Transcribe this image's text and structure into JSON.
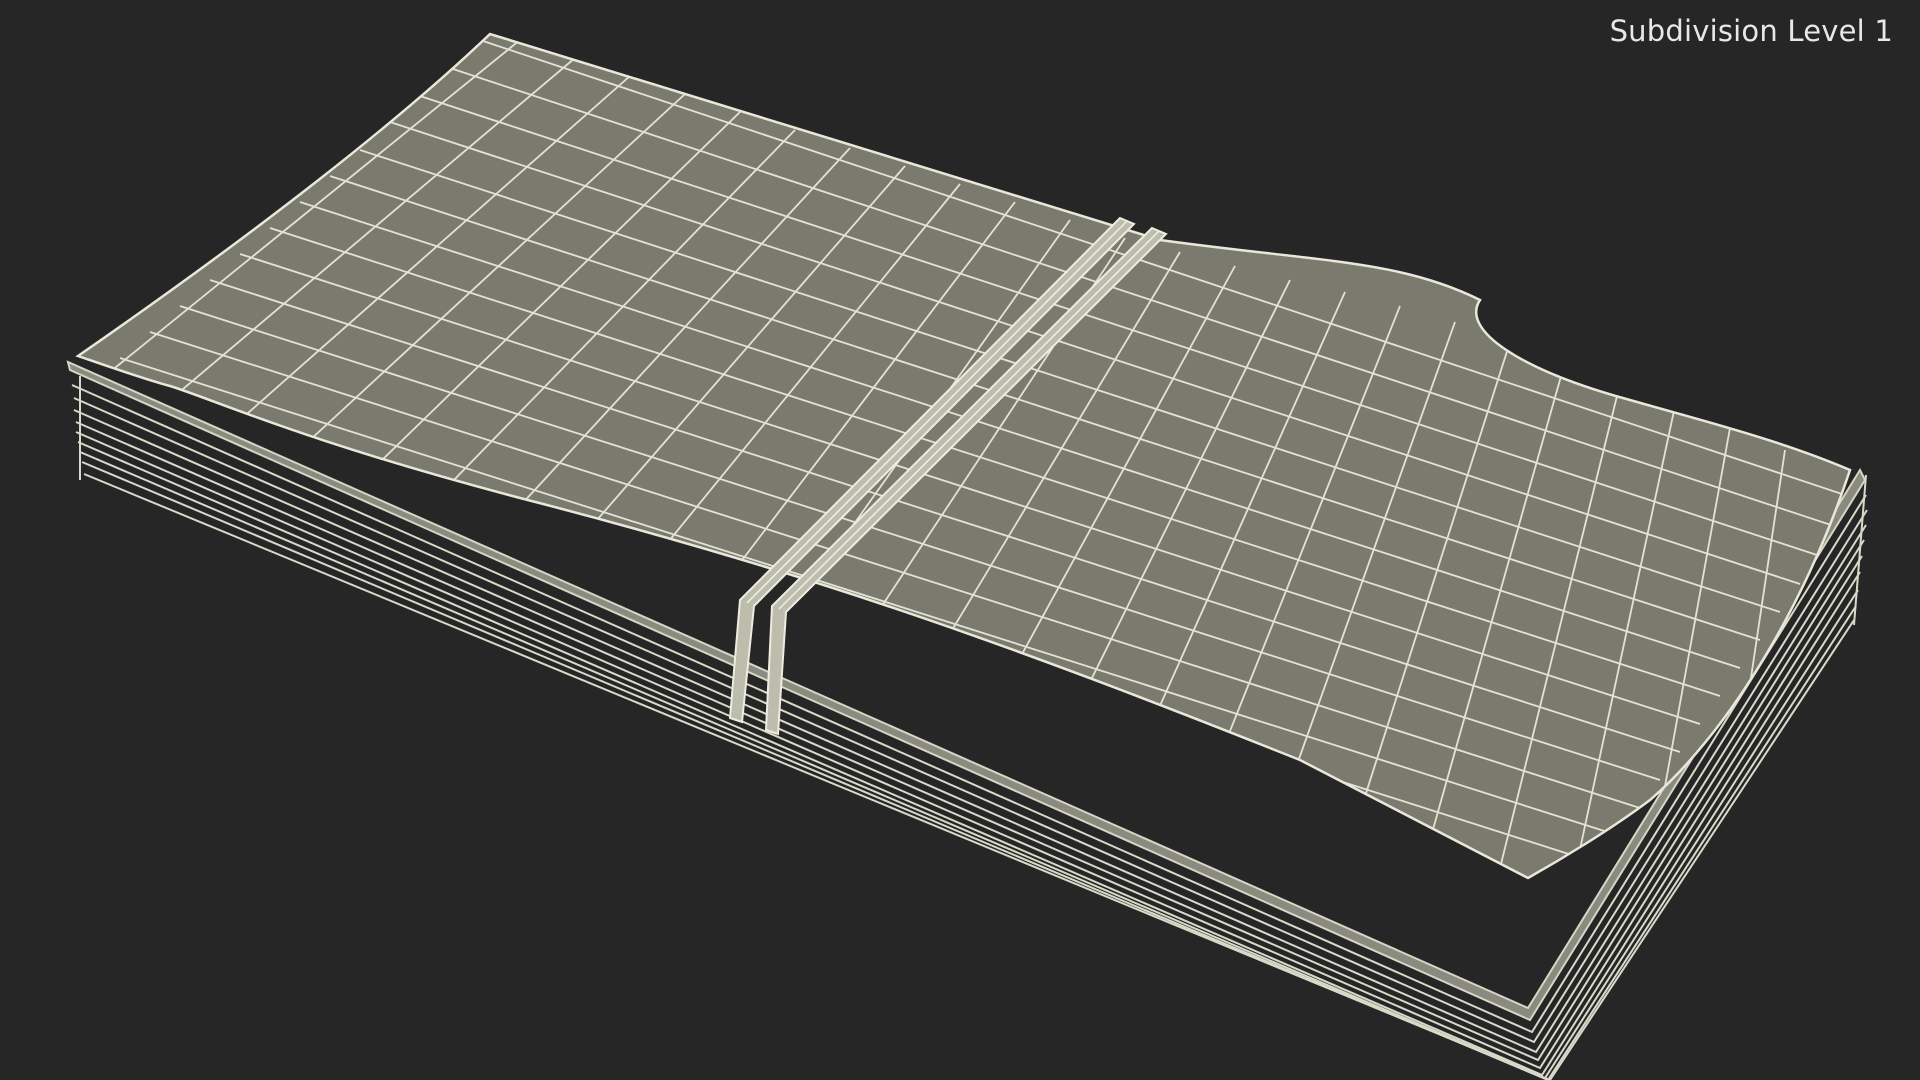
{
  "viewport": {
    "overlay_label": "Subdivision Level 1"
  },
  "scene": {
    "object_icon": "money-stack-wireframe-icon",
    "colors": {
      "background": "#262626",
      "surface": "#7a7b6e",
      "wire": "#e6e6d8",
      "stack_edge": "#cfcfbf"
    }
  }
}
